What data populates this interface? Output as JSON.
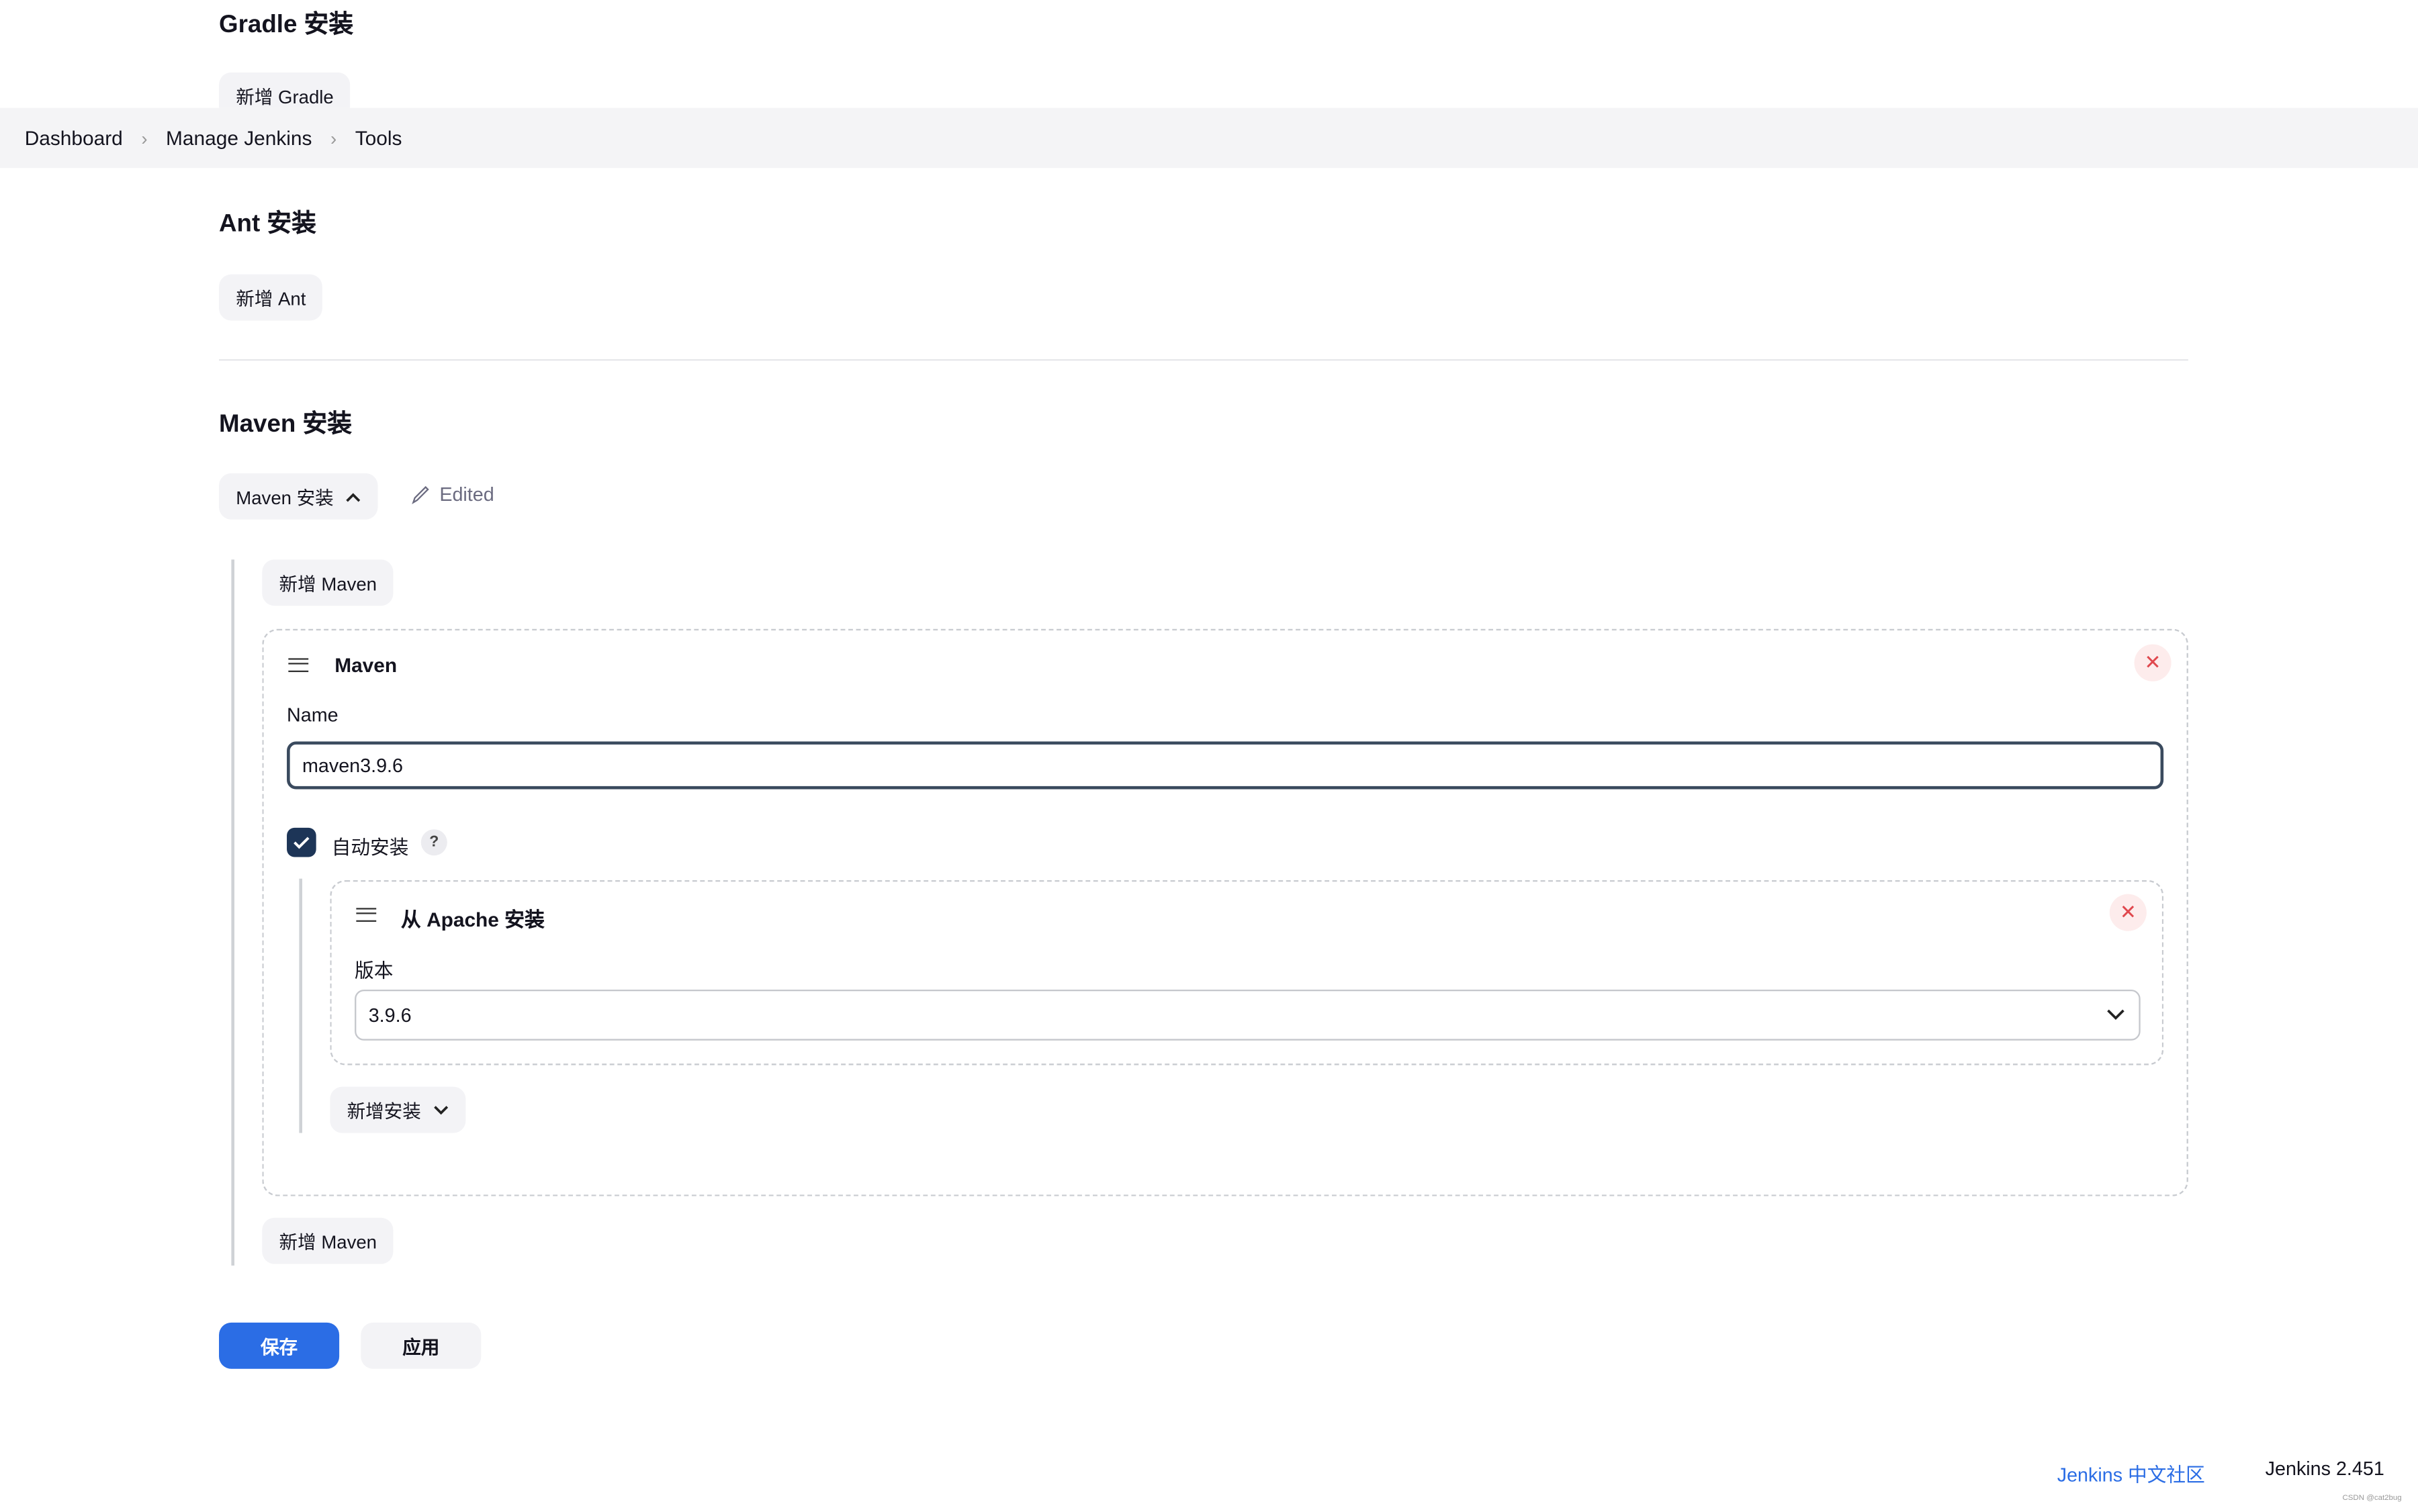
{
  "breadcrumb": {
    "items": [
      "Dashboard",
      "Manage Jenkins",
      "Tools"
    ]
  },
  "gradle": {
    "title": "Gradle 安装",
    "add_button": "新增 Gradle"
  },
  "ant": {
    "title": "Ant 安装",
    "add_button": "新增 Ant"
  },
  "maven": {
    "title": "Maven 安装",
    "toggle_button": "Maven 安装",
    "edited_label": "Edited",
    "add_button_top": "新增 Maven",
    "add_button_bottom": "新增 Maven",
    "installation": {
      "header": "Maven",
      "name_label": "Name",
      "name_value": "maven3.9.6",
      "auto_install_label": "自动安装",
      "auto_install_checked": true,
      "help": "?",
      "installer": {
        "header": "从 Apache 安装",
        "version_label": "版本",
        "version_value": "3.9.6"
      },
      "add_installer_button": "新增安装"
    }
  },
  "actions": {
    "save": "保存",
    "apply": "应用"
  },
  "footer": {
    "community_link": "Jenkins 中文社区",
    "version": "Jenkins 2.451"
  },
  "watermark": "CSDN @cat2bug",
  "colors": {
    "primary": "#2b6de5",
    "checkbox": "#1d3557",
    "link": "#2b6de5"
  }
}
